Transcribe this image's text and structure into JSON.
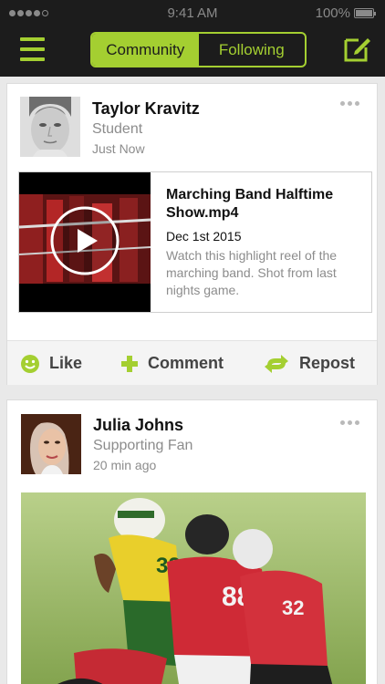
{
  "status": {
    "time": "9:41 AM",
    "battery": "100%"
  },
  "nav": {
    "tabs": [
      {
        "label": "Community",
        "active": true
      },
      {
        "label": "Following",
        "active": false
      }
    ],
    "accent": "#a4cf31",
    "bar_color": "#1c1c1c",
    "icons": {
      "menu": "hamburger-icon",
      "compose": "compose-icon"
    }
  },
  "posts": [
    {
      "author": "Taylor Kravitz",
      "role": "Student",
      "time": "Just Now",
      "attachment": {
        "title": "Marching Band Halftime Show.mp4",
        "date": "Dec 1st 2015",
        "description": "Watch this highlight reel of the marching band. Shot from last nights game."
      },
      "actions": {
        "like": "Like",
        "comment": "Comment",
        "repost": "Repost"
      }
    },
    {
      "author": "Julia Johns",
      "role": "Supporting Fan",
      "time": "20 min ago"
    }
  ]
}
